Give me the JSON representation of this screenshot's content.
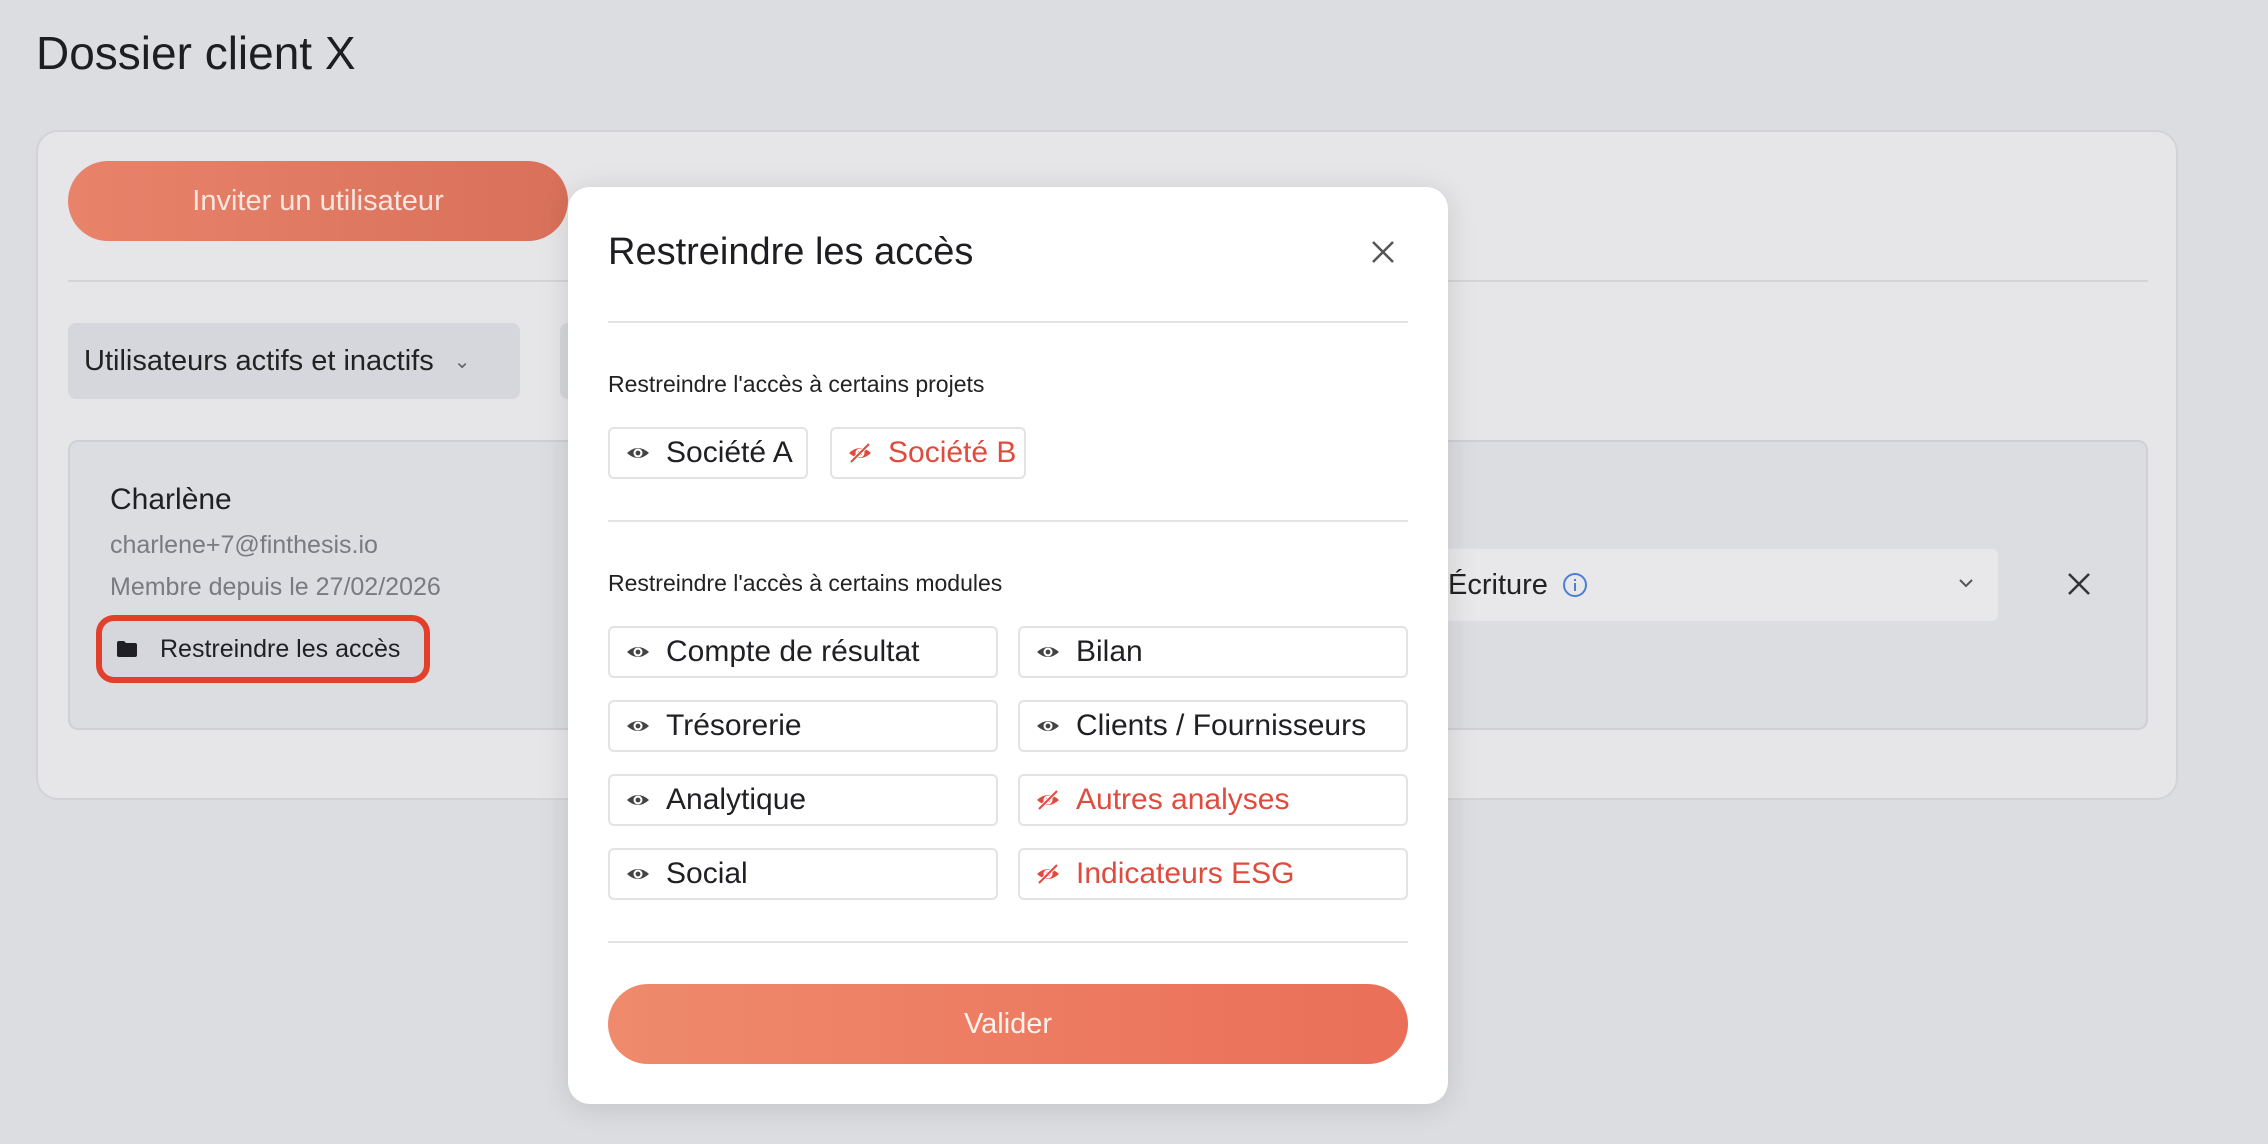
{
  "page": {
    "title": "Dossier client X"
  },
  "toolbar": {
    "invite_label": "Inviter un utilisateur"
  },
  "filters": {
    "status_label": "Utilisateurs actifs et inactifs"
  },
  "user": {
    "name": "Charlène",
    "email": "charlene+7@finthesis.io",
    "member_since": "Membre depuis le 27/02/2026",
    "restrict_label": "Restreindre les accès",
    "role": "Écriture"
  },
  "modal": {
    "title": "Restreindre les accès",
    "projects_label": "Restreindre l'accès à certains projets",
    "projects": [
      {
        "label": "Société A",
        "visible": true
      },
      {
        "label": "Société B",
        "visible": false
      }
    ],
    "modules_label": "Restreindre l'accès à certains modules",
    "modules": [
      {
        "label": "Compte de résultat",
        "visible": true
      },
      {
        "label": "Bilan",
        "visible": true
      },
      {
        "label": "Trésorerie",
        "visible": true
      },
      {
        "label": "Clients / Fournisseurs",
        "visible": true
      },
      {
        "label": "Analytique",
        "visible": true
      },
      {
        "label": "Autres analyses",
        "visible": false
      },
      {
        "label": "Social",
        "visible": true
      },
      {
        "label": "Indicateurs ESG",
        "visible": false
      }
    ],
    "validate_label": "Valider"
  },
  "colors": {
    "accent": "#ea7a62",
    "hidden": "#e04b3d",
    "highlight": "#e2402c"
  }
}
